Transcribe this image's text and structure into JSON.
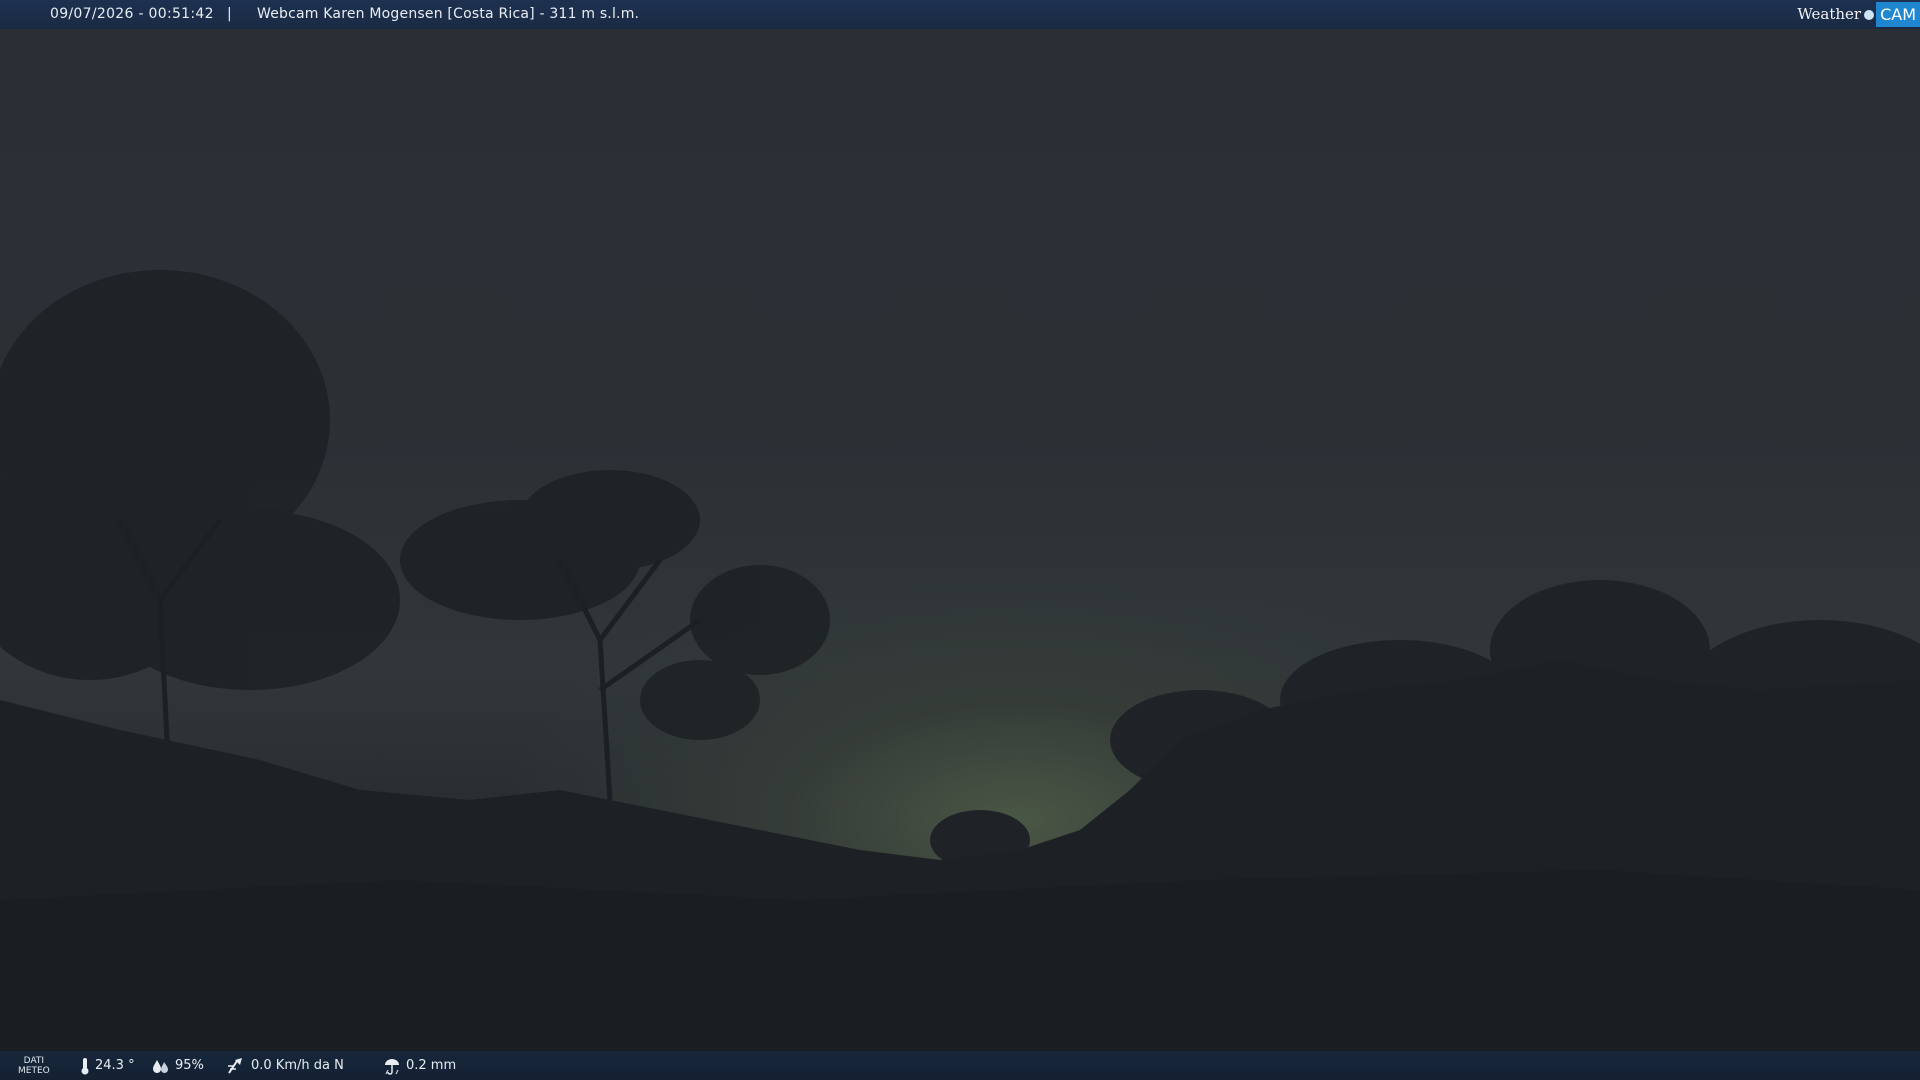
{
  "header": {
    "datetime": "09/07/2026 - 00:51:42",
    "separator": "|",
    "title": "Webcam Karen Mogensen [Costa Rica]  - 311 m s.l.m.",
    "logo": {
      "word": "Weather",
      "accent": "CAM",
      "accent_color": "#1f87cf"
    }
  },
  "footer": {
    "label_line1": "DATI",
    "label_line2": "METEO",
    "temperature": "24.3 °",
    "humidity": "95%",
    "wind": "0.0 Km/h da N",
    "rain": "0.2 mm",
    "icons": [
      "thermometer-icon",
      "humidity-drops-icon",
      "wind-icon",
      "rain-icon"
    ]
  },
  "colors": {
    "topbar": "#1d3150",
    "bottombar": "#17263b",
    "sky": "#2b3035",
    "glow": "#4a5645"
  }
}
